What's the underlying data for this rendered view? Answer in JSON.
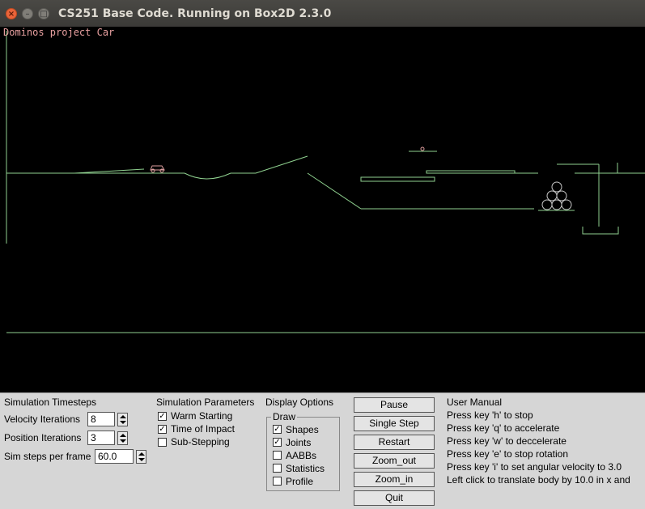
{
  "window": {
    "title": "CS251 Base Code. Running on Box2D 2.3.0",
    "close_glyph": "×",
    "minimize_glyph": "–",
    "maximize_glyph": "□"
  },
  "scene": {
    "label": "Dominos project Car",
    "line_color": "#8fd18f",
    "body_color": "#e0a0a0",
    "background": "#000000"
  },
  "timesteps": {
    "heading": "Simulation Timesteps",
    "velocity_label": "Velocity Iterations",
    "velocity_value": "8",
    "position_label": "Position Iterations",
    "position_value": "3",
    "steps_label": "Sim steps per frame",
    "steps_value": "60.0"
  },
  "params": {
    "heading": "Simulation Parameters",
    "items": [
      {
        "label": "Warm Starting",
        "check": "✓"
      },
      {
        "label": "Time of Impact",
        "check": "✓"
      },
      {
        "label": "Sub-Stepping",
        "check": ""
      }
    ]
  },
  "display": {
    "heading": "Display Options",
    "group_label": "Draw",
    "items": [
      {
        "label": "Shapes",
        "check": "✓"
      },
      {
        "label": "Joints",
        "check": "✓"
      },
      {
        "label": "AABBs",
        "check": ""
      },
      {
        "label": "Statistics",
        "check": ""
      },
      {
        "label": "Profile",
        "check": ""
      }
    ]
  },
  "buttons": {
    "pause": "Pause",
    "single_step": "Single Step",
    "restart": "Restart",
    "zoom_out": "Zoom_out",
    "zoom_in": "Zoom_in",
    "quit": "Quit"
  },
  "manual": {
    "heading": "User Manual",
    "lines": [
      "Press key 'h' to stop",
      "Press key 'q' to accelerate",
      "Press key 'w' to deccelerate",
      "Press key 'e' to stop rotation",
      "Press key 'i' to set angular velocity to 3.0",
      "Left click to translate body by 10.0 in x and"
    ]
  }
}
